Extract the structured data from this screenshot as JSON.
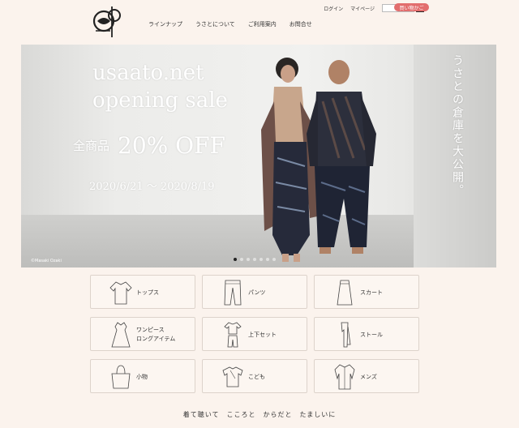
{
  "header": {
    "nav": [
      "ラインナップ",
      "うさとについて",
      "ご利用案内",
      "お問合せ"
    ],
    "util": {
      "login": "ログイン",
      "mypage": "マイページ",
      "cart": "買い物かご"
    },
    "search": {
      "value": "",
      "placeholder": ""
    }
  },
  "hero": {
    "title_line1": "usaato.net",
    "title_line2": "opening sale",
    "sale_prefix": "全商品",
    "sale_value": "20% OFF",
    "dates": "2020/6/21 ～ 2020/8/19",
    "vertical_text": "うさとの倉庫を大公開。",
    "credit": "©Masaki Ozaki",
    "slide_count": 7,
    "active_slide": 1
  },
  "categories": [
    {
      "label": "トップス",
      "icon": "tops-icon"
    },
    {
      "label": "パンツ",
      "icon": "pants-icon"
    },
    {
      "label": "スカート",
      "icon": "skirt-icon"
    },
    {
      "label": "ワンピース\nロングアイテム",
      "icon": "dress-icon"
    },
    {
      "label": "上下セット",
      "icon": "set-icon"
    },
    {
      "label": "ストール",
      "icon": "stole-icon"
    },
    {
      "label": "小物",
      "icon": "bag-icon"
    },
    {
      "label": "こども",
      "icon": "kids-icon"
    },
    {
      "label": "メンズ",
      "icon": "mens-icon"
    }
  ],
  "tagline": "着て聴いて　こころと　からだと　たましいに",
  "colors": {
    "background": "#fbf3ed",
    "cart_button": "#e26d6d"
  }
}
